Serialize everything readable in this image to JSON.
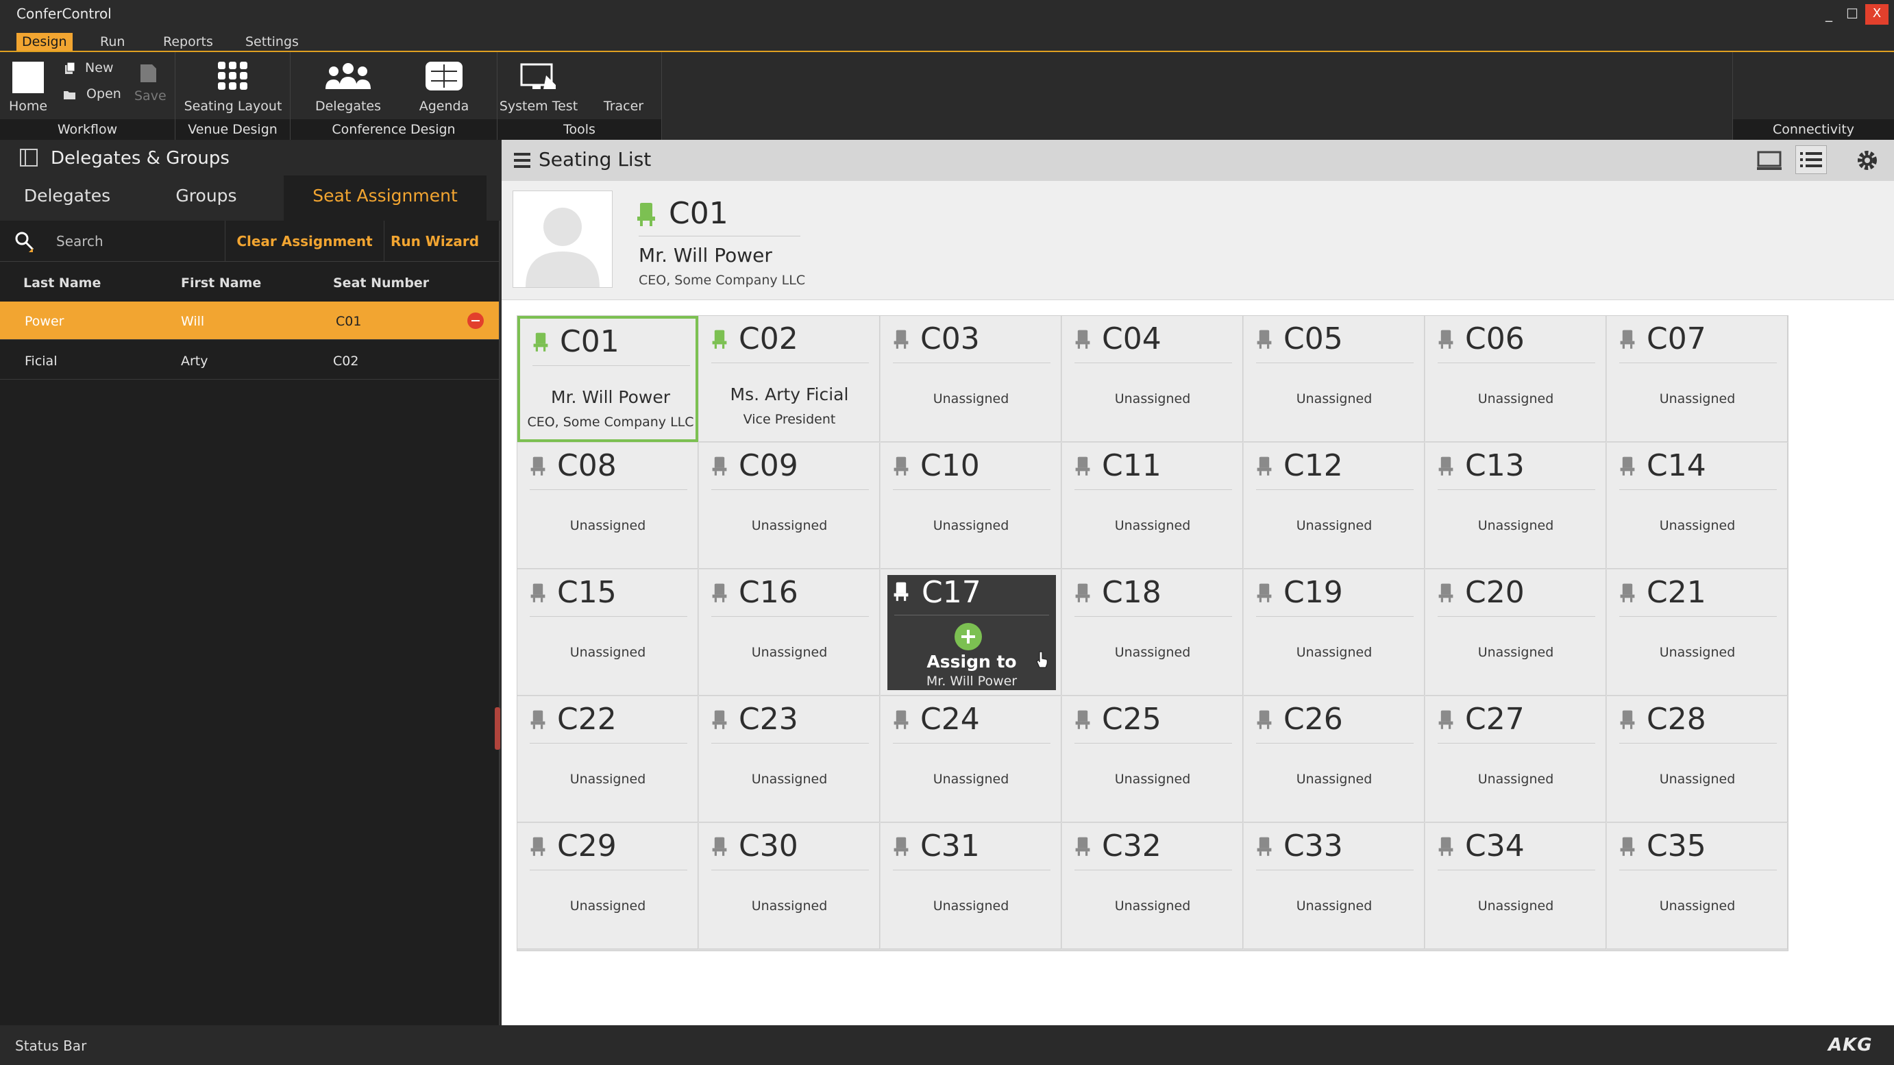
{
  "app": {
    "title": "ConferControl"
  },
  "window": {
    "minimize": "_",
    "maximize": "☐",
    "close": "X"
  },
  "menu": [
    "Design",
    "Run",
    "Reports",
    "Settings"
  ],
  "ribbon": {
    "workflow": {
      "home": "Home",
      "new": "New",
      "open": "Open",
      "save": "Save",
      "caption": "Workflow"
    },
    "venue": {
      "seating_layout": "Seating Layout",
      "caption": "Venue Design"
    },
    "conference": {
      "delegates": "Delegates",
      "agenda": "Agenda",
      "caption": "Conference Design"
    },
    "tools": {
      "system_test": "System Test",
      "tracer": "Tracer",
      "caption": "Tools"
    },
    "connectivity": {
      "caption": "Connectivity"
    }
  },
  "left_panel": {
    "title": "Delegates & Groups",
    "tabs": [
      "Delegates",
      "Groups",
      "Seat Assignment"
    ],
    "search_placeholder": "Search",
    "clear_assignment": "Clear Assignment",
    "run_wizard": "Run Wizard",
    "columns": [
      "Last Name",
      "First Name",
      "Seat Number"
    ],
    "rows": [
      {
        "last": "Power",
        "first": "Will",
        "seat": "C01"
      },
      {
        "last": "Ficial",
        "first": "Arty",
        "seat": "C02"
      }
    ]
  },
  "right_panel": {
    "title": "Seating List",
    "detail": {
      "seat": "C01",
      "name": "Mr. Will Power",
      "title": "CEO, Some Company LLC"
    },
    "unassigned_label": "Unassigned",
    "assign_to_label": "Assign to",
    "assign_to_name": "Mr. Will Power",
    "seats": [
      {
        "id": "C01",
        "name": "Mr. Will Power",
        "title": "CEO, Some Company LLC"
      },
      {
        "id": "C02",
        "name": "Ms. Arty Ficial",
        "title": "Vice President"
      },
      {
        "id": "C03"
      },
      {
        "id": "C04"
      },
      {
        "id": "C05"
      },
      {
        "id": "C06"
      },
      {
        "id": "C07"
      },
      {
        "id": "C08"
      },
      {
        "id": "C09"
      },
      {
        "id": "C10"
      },
      {
        "id": "C11"
      },
      {
        "id": "C12"
      },
      {
        "id": "C13"
      },
      {
        "id": "C14"
      },
      {
        "id": "C15"
      },
      {
        "id": "C16"
      },
      {
        "id": "C17"
      },
      {
        "id": "C18"
      },
      {
        "id": "C19"
      },
      {
        "id": "C20"
      },
      {
        "id": "C21"
      },
      {
        "id": "C22"
      },
      {
        "id": "C23"
      },
      {
        "id": "C24"
      },
      {
        "id": "C25"
      },
      {
        "id": "C26"
      },
      {
        "id": "C27"
      },
      {
        "id": "C28"
      },
      {
        "id": "C29"
      },
      {
        "id": "C30"
      },
      {
        "id": "C31"
      },
      {
        "id": "C32"
      },
      {
        "id": "C33"
      },
      {
        "id": "C34"
      },
      {
        "id": "C35"
      }
    ]
  },
  "status": {
    "text": "Status Bar",
    "brand": "AKG"
  },
  "colors": {
    "accent": "#f2a531",
    "assigned": "#7cc052",
    "remove": "#e2402c",
    "hover_card": "#3b3b3b"
  },
  "icons": {
    "home": "home-icon",
    "new": "new-file-icon",
    "open": "folder-open-icon",
    "save": "save-icon",
    "seating_layout": "seating-grid-icon",
    "delegates": "people-icon",
    "agenda": "agenda-icon",
    "system_test": "monitor-icon",
    "search": "search-icon",
    "chair": "chair-icon",
    "settings": "gear-icon",
    "list_view": "list-icon",
    "screen_view": "screen-icon"
  }
}
